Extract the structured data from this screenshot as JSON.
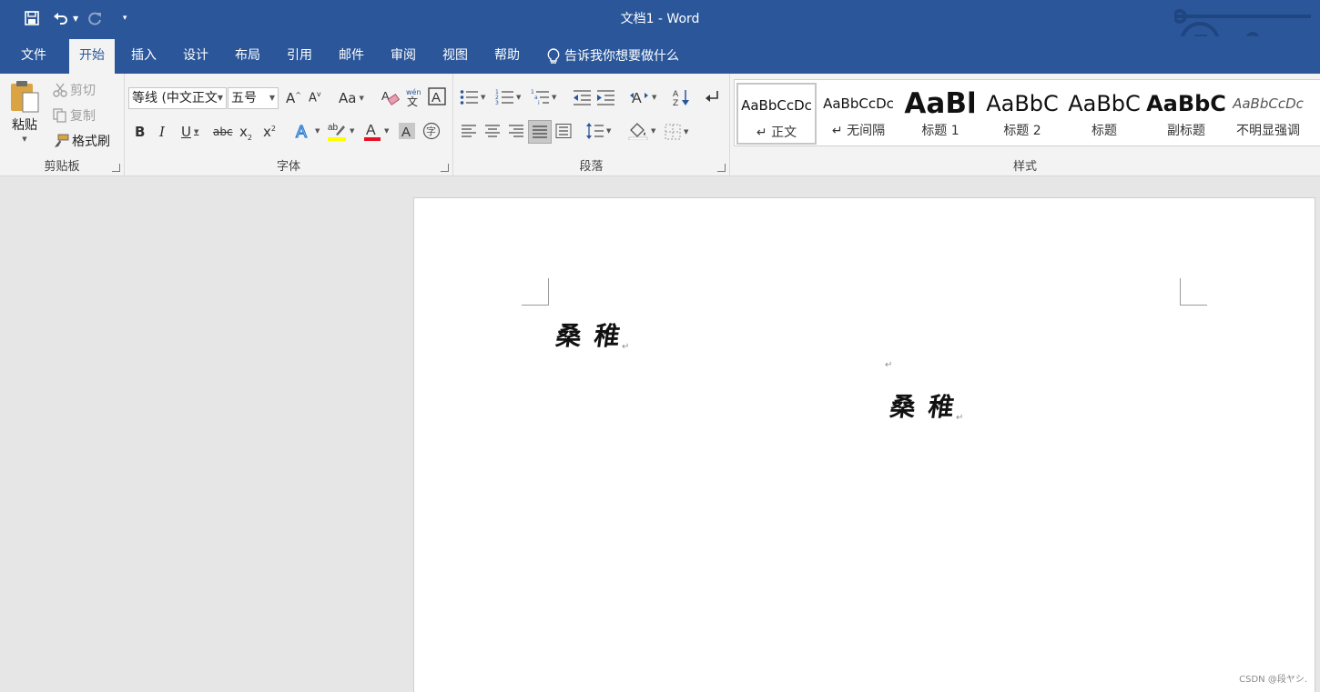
{
  "window": {
    "title": "文档1  -  Word"
  },
  "tabs": [
    {
      "label": "文件"
    },
    {
      "label": "开始"
    },
    {
      "label": "插入"
    },
    {
      "label": "设计"
    },
    {
      "label": "布局"
    },
    {
      "label": "引用"
    },
    {
      "label": "邮件"
    },
    {
      "label": "审阅"
    },
    {
      "label": "视图"
    },
    {
      "label": "帮助"
    }
  ],
  "active_tab": "开始",
  "tellme": {
    "label": "告诉我你想要做什么"
  },
  "clipboard": {
    "paste": "粘贴",
    "cut": "剪切",
    "copy": "复制",
    "format_painter": "格式刷",
    "group_label": "剪贴板"
  },
  "font": {
    "name": "等线 (中文正文",
    "size": "五号",
    "group_label": "字体"
  },
  "paragraph": {
    "group_label": "段落"
  },
  "styles": {
    "group_label": "样式",
    "items": [
      {
        "sample": "AaBbCcDc",
        "name": "↵ 正文"
      },
      {
        "sample": "AaBbCcDc",
        "name": "↵ 无间隔"
      },
      {
        "sample": "AaBl",
        "name": "标题 1"
      },
      {
        "sample": "AaBbC",
        "name": "标题 2"
      },
      {
        "sample": "AaBbC",
        "name": "标题"
      },
      {
        "sample": "AaBbC",
        "name": "副标题"
      },
      {
        "sample": "AaBbCcDc",
        "name": "不明显强调"
      }
    ]
  },
  "document": {
    "line1": "桑稚",
    "line2": "桑稚",
    "para_mark": "↵"
  },
  "watermark": "CSDN @段ヤシ.",
  "colors": {
    "brand": "#2b579a",
    "ribbon_bg": "#f3f3f3",
    "font_color_underline": "#e81123",
    "highlight_underline": "#ffff00"
  }
}
